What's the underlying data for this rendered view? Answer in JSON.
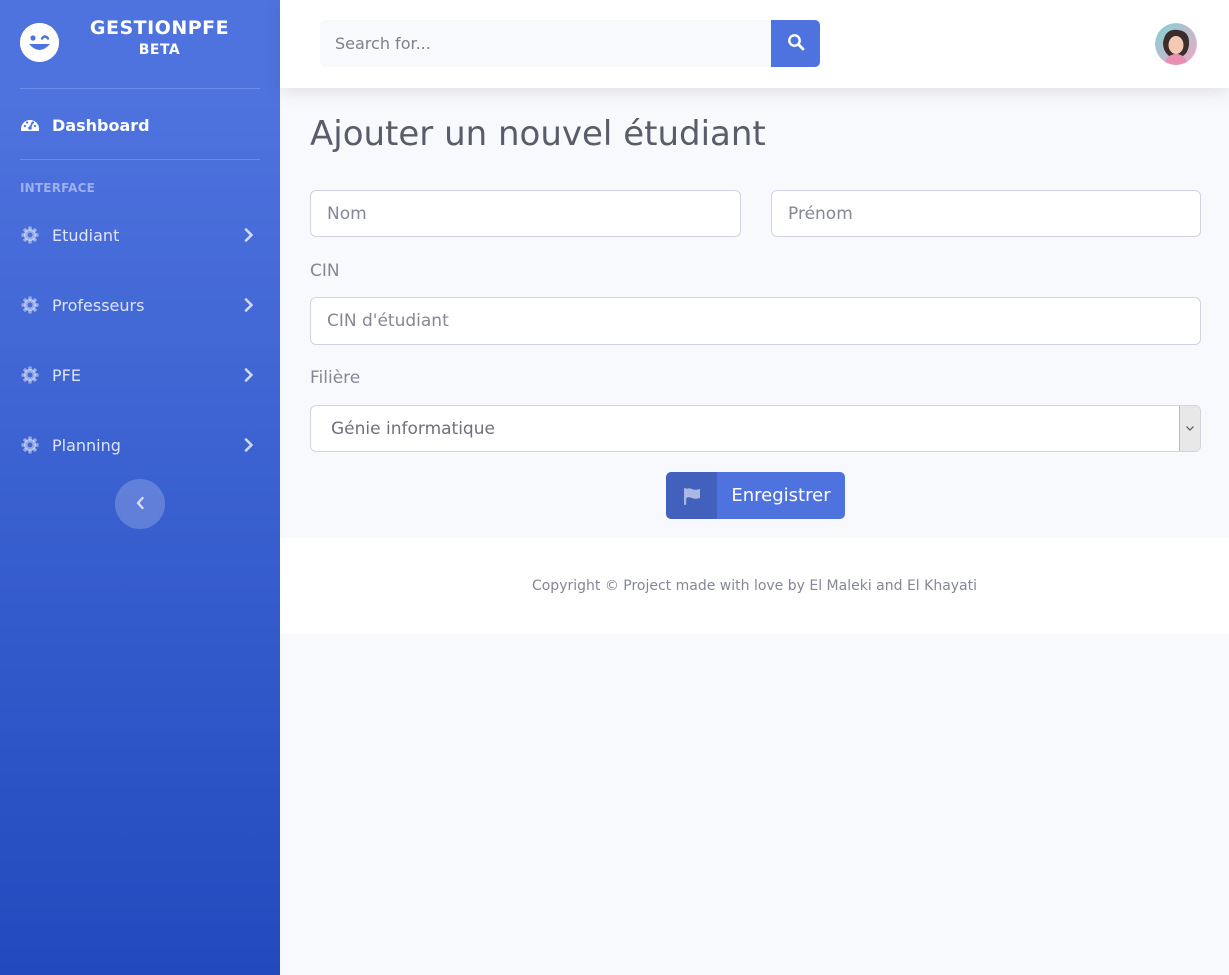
{
  "brand": {
    "title": "GESTIONPFE",
    "subtitle": "BETA",
    "icon": "laugh-wink-icon"
  },
  "sidebar": {
    "dashboard_label": "Dashboard",
    "heading": "INTERFACE",
    "items": [
      {
        "label": "Etudiant",
        "icon": "gear-icon"
      },
      {
        "label": "Professeurs",
        "icon": "gear-icon"
      },
      {
        "label": "PFE",
        "icon": "gear-icon"
      },
      {
        "label": "Planning",
        "icon": "gear-icon"
      }
    ]
  },
  "topbar": {
    "search_placeholder": "Search for..."
  },
  "main": {
    "title": "Ajouter un nouvel étudiant",
    "nom_placeholder": "Nom",
    "prenom_placeholder": "Prénom",
    "cin_label": "CIN",
    "cin_placeholder": "CIN d'étudiant",
    "filiere_label": "Filière",
    "filiere_selected": "Génie informatique",
    "save_label": "Enregistrer"
  },
  "footer": {
    "text": "Copyright © Project made with love by El Maleki and El Khayati"
  },
  "colors": {
    "primary": "#4e73df",
    "primary_dark": "#224abe",
    "bg": "#f8f9fc",
    "text": "#858796"
  }
}
